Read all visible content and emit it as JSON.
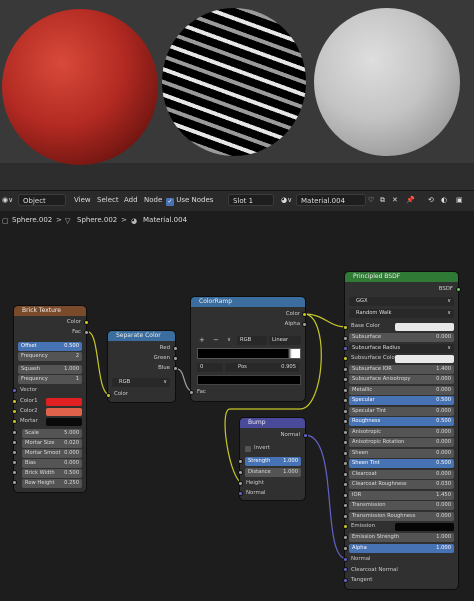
{
  "header": {
    "mode": "Object",
    "menus": [
      "View",
      "Select",
      "Add",
      "Node"
    ],
    "use_nodes": "Use Nodes",
    "slot": "Slot 1",
    "material": "Material.004"
  },
  "breadcrumb": {
    "object": "Sphere.002",
    "mesh": "Sphere.002",
    "material": "Material.004"
  },
  "brick": {
    "title": "Brick Texture",
    "out_color": "Color",
    "out_fac": "Fac",
    "offset_label": "Offset",
    "offset": "0.500",
    "frequency_label": "Frequency",
    "frequency": "2",
    "squash_label": "Squash",
    "squash": "1.000",
    "squash_freq_label": "Frequency",
    "squash_freq": "1",
    "vector": "Vector",
    "color1": "Color1",
    "color2": "Color2",
    "mortar": "Mortar",
    "scale_label": "Scale",
    "scale": "5.000",
    "mortar_size_label": "Mortar Size",
    "mortar_size": "0.020",
    "mortar_smooth_label": "Mortar Smoot",
    "mortar_smooth": "0.000",
    "bias_label": "Bias",
    "bias": "0.000",
    "brick_width_label": "Brick Width",
    "brick_width": "0.500",
    "row_height_label": "Row Height",
    "row_height": "0.250"
  },
  "separate": {
    "title": "Separate Color",
    "red": "Red",
    "green": "Green",
    "blue": "Blue",
    "mode": "RGB",
    "color": "Color"
  },
  "ramp": {
    "title": "ColorRamp",
    "out_color": "Color",
    "out_alpha": "Alpha",
    "plus": "+",
    "minus": "−",
    "menu": "∨",
    "mode": "RGB",
    "interp": "Linear",
    "index": "0",
    "pos_label": "Pos",
    "pos": "0.905",
    "fac": "Fac"
  },
  "bump": {
    "title": "Bump",
    "normal_out": "Normal",
    "invert": "Invert",
    "strength_label": "Strength",
    "strength": "1.000",
    "distance_label": "Distance",
    "distance": "1.000",
    "height": "Height",
    "normal_in": "Normal"
  },
  "bsdf": {
    "title": "Principled BSDF",
    "out": "BSDF",
    "dist": "GGX",
    "sss_method": "Random Walk",
    "base_color": "Base Color",
    "subsurface_label": "Subsurface",
    "subsurface": "0.000",
    "subsurface_radius": "Subsurface Radius",
    "subsurface_color": "Subsurface Color",
    "subsurface_ior_label": "Subsurface IOR",
    "subsurface_ior": "1.400",
    "subsurface_aniso_label": "Subsurface Anisotropy",
    "subsurface_aniso": "0.000",
    "metallic_label": "Metallic",
    "metallic": "0.000",
    "specular_label": "Specular",
    "specular": "0.500",
    "specular_tint_label": "Specular Tint",
    "specular_tint": "0.000",
    "roughness_label": "Roughness",
    "roughness": "0.500",
    "anisotropic_label": "Anisotropic",
    "anisotropic": "0.000",
    "aniso_rot_label": "Anisotropic Rotation",
    "aniso_rot": "0.000",
    "sheen_label": "Sheen",
    "sheen": "0.000",
    "sheen_tint_label": "Sheen Tint",
    "sheen_tint": "0.500",
    "clearcoat_label": "Clearcoat",
    "clearcoat": "0.000",
    "clearcoat_rough_label": "Clearcoat Roughness",
    "clearcoat_rough": "0.030",
    "ior_label": "IOR",
    "ior": "1.450",
    "transmission_label": "Transmission",
    "transmission": "0.000",
    "trans_rough_label": "Transmission Roughness",
    "trans_rough": "0.000",
    "emission": "Emission",
    "emission_strength_label": "Emission Strength",
    "emission_strength": "1.000",
    "alpha_label": "Alpha",
    "alpha": "1.000",
    "normal": "Normal",
    "clearcoat_normal": "Clearcoat Normal",
    "tangent": "Tangent"
  },
  "colors": {
    "brick_color1": "#e02020",
    "brick_color2": "#e0624a",
    "brick_mortar": "#0a0a0a",
    "texture_header": "#7a4b2a",
    "converter_header": "#3b6e9e",
    "vector_header": "#4a4a9a",
    "shader_header": "#2f7a35",
    "link_yellow": "#c7c729",
    "link_purple": "#6363c7"
  }
}
